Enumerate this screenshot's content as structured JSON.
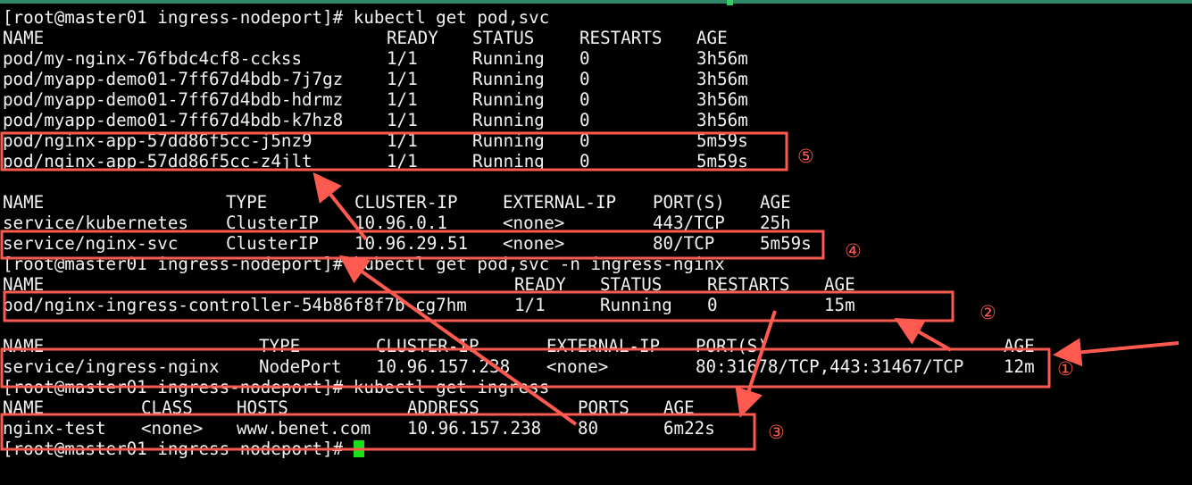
{
  "colors": {
    "background": "#000000",
    "text": "#f2f2f2",
    "annotation": "#ff5a4f",
    "cursor": "#19e019",
    "window_bar": "#2f8a6a"
  },
  "terminal": {
    "cmd1": "[root@master01 ingress-nodeport]# kubectl get pod,svc",
    "pods": {
      "header": [
        "NAME",
        "READY",
        "STATUS",
        "RESTARTS",
        "AGE"
      ],
      "rows": [
        [
          "pod/my-nginx-76fbdc4cf8-cckss",
          "1/1",
          "Running",
          "0",
          "3h56m"
        ],
        [
          "pod/myapp-demo01-7ff67d4bdb-7j7gz",
          "1/1",
          "Running",
          "0",
          "3h56m"
        ],
        [
          "pod/myapp-demo01-7ff67d4bdb-hdrmz",
          "1/1",
          "Running",
          "0",
          "3h56m"
        ],
        [
          "pod/myapp-demo01-7ff67d4bdb-k7hz8",
          "1/1",
          "Running",
          "0",
          "3h56m"
        ],
        [
          "pod/nginx-app-57dd86f5cc-j5nz9",
          "1/1",
          "Running",
          "0",
          "5m59s"
        ],
        [
          "pod/nginx-app-57dd86f5cc-z4jlt",
          "1/1",
          "Running",
          "0",
          "5m59s"
        ]
      ]
    },
    "svcs": {
      "header": [
        "NAME",
        "TYPE",
        "CLUSTER-IP",
        "EXTERNAL-IP",
        "PORT(S)",
        "AGE"
      ],
      "rows": [
        [
          "service/kubernetes",
          "ClusterIP",
          "10.96.0.1",
          "<none>",
          "443/TCP",
          "25h"
        ],
        [
          "service/nginx-svc",
          "ClusterIP",
          "10.96.29.51",
          "<none>",
          "80/TCP",
          "5m59s"
        ]
      ]
    },
    "cmd2": "[root@master01 ingress-nodeport]# kubectl get pod,svc -n ingress-nginx",
    "ingress_pods": {
      "header": [
        "NAME",
        "READY",
        "STATUS",
        "RESTARTS",
        "AGE"
      ],
      "rows": [
        [
          "pod/nginx-ingress-controller-54b86f8f7b-cg7hm",
          "1/1",
          "Running",
          "0",
          "15m"
        ]
      ]
    },
    "ingress_svcs": {
      "header": [
        "NAME",
        "TYPE",
        "CLUSTER-IP",
        "EXTERNAL-IP",
        "PORT(S)",
        "AGE"
      ],
      "rows": [
        [
          "service/ingress-nginx",
          "NodePort",
          "10.96.157.238",
          "<none>",
          "80:31678/TCP,443:31467/TCP",
          "12m"
        ]
      ]
    },
    "cmd3": "[root@master01 ingress-nodeport]# kubectl get ingress",
    "ingress": {
      "header": [
        "NAME",
        "CLASS",
        "HOSTS",
        "ADDRESS",
        "PORTS",
        "AGE"
      ],
      "rows": [
        [
          "nginx-test",
          "<none>",
          "www.benet.com",
          "10.96.157.238",
          "80",
          "6m22s"
        ]
      ]
    },
    "prompt": "[root@master01 ingress-nodeport]#"
  },
  "annotations": {
    "n1": "①",
    "n2": "②",
    "n3": "③",
    "n4": "④",
    "n5": "⑤"
  }
}
